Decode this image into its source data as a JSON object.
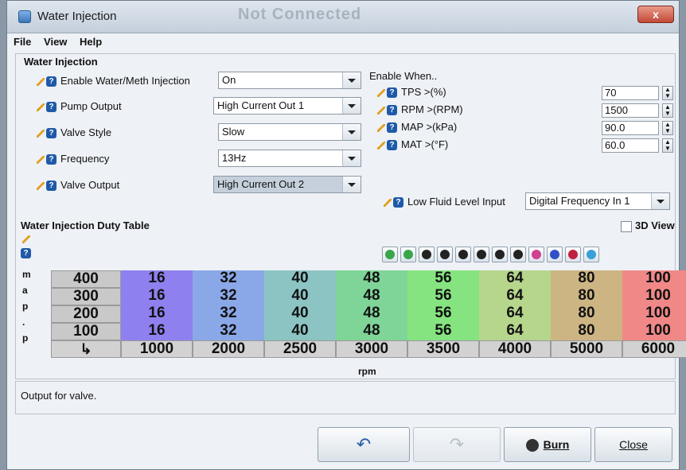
{
  "window": {
    "title": "Water Injection",
    "ghost_title": "Not Connected",
    "close_glyph": "x"
  },
  "menu": {
    "file": "File",
    "view": "View",
    "help": "Help"
  },
  "settings": {
    "group_title": "Water Injection",
    "enable_label": "Enable Water/Meth Injection",
    "enable_value": "On",
    "pump_label": "Pump Output",
    "pump_value": "High Current Out 1",
    "valve_style_label": "Valve Style",
    "valve_style_value": "Slow",
    "frequency_label": "Frequency",
    "frequency_value": "13Hz",
    "valve_output_label": "Valve Output",
    "valve_output_value": "High Current Out 2"
  },
  "enable_when": {
    "title": "Enable When..",
    "tps_label": "TPS >(%)",
    "tps_value": "70",
    "rpm_label": "RPM >(RPM)",
    "rpm_value": "1500",
    "map_label": "MAP >(kPa)",
    "map_value": "90.0",
    "mat_label": "MAT >(°F)",
    "mat_value": "60.0",
    "fluid_label": "Low Fluid Level Input",
    "fluid_value": "Digital Frequency In 1"
  },
  "table": {
    "title": "Water Injection Duty Table",
    "view3d_label": "3D View",
    "y_axis_letters": [
      "m",
      "a",
      "p",
      ".",
      "p"
    ],
    "x_axis_label": "rpm",
    "rows": [
      "400",
      "300",
      "200",
      "100"
    ],
    "cols": [
      "1000",
      "2000",
      "2500",
      "3000",
      "3500",
      "4000",
      "5000",
      "6000"
    ],
    "values": [
      [
        "16",
        "32",
        "40",
        "48",
        "56",
        "64",
        "80",
        "100"
      ],
      [
        "16",
        "32",
        "40",
        "48",
        "56",
        "64",
        "80",
        "100"
      ],
      [
        "16",
        "32",
        "40",
        "48",
        "56",
        "64",
        "80",
        "100"
      ],
      [
        "16",
        "32",
        "40",
        "48",
        "56",
        "64",
        "80",
        "100"
      ]
    ],
    "col_colors": [
      "#8f80f0",
      "#8aa8e8",
      "#8cc4c4",
      "#7fd498",
      "#86e480",
      "#b6d68c",
      "#cdb583",
      "#f08888"
    ],
    "toolbar_icons": [
      "increase-green-icon",
      "decrease-green-icon",
      "set-value-icon",
      "shift-up-icon",
      "shift-down-icon",
      "subtract-icon",
      "add-icon",
      "multiply-icon",
      "interpolate-icon",
      "horizontal-lines-icon",
      "vertical-lines-icon",
      "color-gradient-icon"
    ]
  },
  "status": {
    "text": "Output for valve."
  },
  "buttons": {
    "burn": "Burn",
    "close": "Close"
  }
}
